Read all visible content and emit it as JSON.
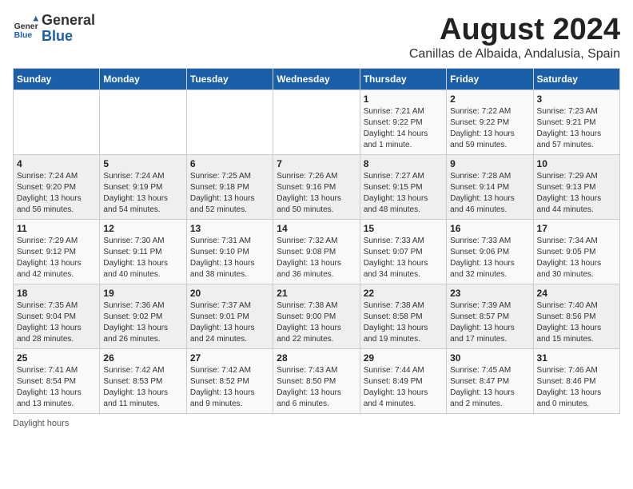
{
  "header": {
    "logo_general": "General",
    "logo_blue": "Blue",
    "month_year": "August 2024",
    "location": "Canillas de Albaida, Andalusia, Spain"
  },
  "columns": [
    "Sunday",
    "Monday",
    "Tuesday",
    "Wednesday",
    "Thursday",
    "Friday",
    "Saturday"
  ],
  "weeks": [
    [
      {
        "day": "",
        "info": ""
      },
      {
        "day": "",
        "info": ""
      },
      {
        "day": "",
        "info": ""
      },
      {
        "day": "",
        "info": ""
      },
      {
        "day": "1",
        "info": "Sunrise: 7:21 AM\nSunset: 9:22 PM\nDaylight: 14 hours\nand 1 minute."
      },
      {
        "day": "2",
        "info": "Sunrise: 7:22 AM\nSunset: 9:22 PM\nDaylight: 13 hours\nand 59 minutes."
      },
      {
        "day": "3",
        "info": "Sunrise: 7:23 AM\nSunset: 9:21 PM\nDaylight: 13 hours\nand 57 minutes."
      }
    ],
    [
      {
        "day": "4",
        "info": "Sunrise: 7:24 AM\nSunset: 9:20 PM\nDaylight: 13 hours\nand 56 minutes."
      },
      {
        "day": "5",
        "info": "Sunrise: 7:24 AM\nSunset: 9:19 PM\nDaylight: 13 hours\nand 54 minutes."
      },
      {
        "day": "6",
        "info": "Sunrise: 7:25 AM\nSunset: 9:18 PM\nDaylight: 13 hours\nand 52 minutes."
      },
      {
        "day": "7",
        "info": "Sunrise: 7:26 AM\nSunset: 9:16 PM\nDaylight: 13 hours\nand 50 minutes."
      },
      {
        "day": "8",
        "info": "Sunrise: 7:27 AM\nSunset: 9:15 PM\nDaylight: 13 hours\nand 48 minutes."
      },
      {
        "day": "9",
        "info": "Sunrise: 7:28 AM\nSunset: 9:14 PM\nDaylight: 13 hours\nand 46 minutes."
      },
      {
        "day": "10",
        "info": "Sunrise: 7:29 AM\nSunset: 9:13 PM\nDaylight: 13 hours\nand 44 minutes."
      }
    ],
    [
      {
        "day": "11",
        "info": "Sunrise: 7:29 AM\nSunset: 9:12 PM\nDaylight: 13 hours\nand 42 minutes."
      },
      {
        "day": "12",
        "info": "Sunrise: 7:30 AM\nSunset: 9:11 PM\nDaylight: 13 hours\nand 40 minutes."
      },
      {
        "day": "13",
        "info": "Sunrise: 7:31 AM\nSunset: 9:10 PM\nDaylight: 13 hours\nand 38 minutes."
      },
      {
        "day": "14",
        "info": "Sunrise: 7:32 AM\nSunset: 9:08 PM\nDaylight: 13 hours\nand 36 minutes."
      },
      {
        "day": "15",
        "info": "Sunrise: 7:33 AM\nSunset: 9:07 PM\nDaylight: 13 hours\nand 34 minutes."
      },
      {
        "day": "16",
        "info": "Sunrise: 7:33 AM\nSunset: 9:06 PM\nDaylight: 13 hours\nand 32 minutes."
      },
      {
        "day": "17",
        "info": "Sunrise: 7:34 AM\nSunset: 9:05 PM\nDaylight: 13 hours\nand 30 minutes."
      }
    ],
    [
      {
        "day": "18",
        "info": "Sunrise: 7:35 AM\nSunset: 9:04 PM\nDaylight: 13 hours\nand 28 minutes."
      },
      {
        "day": "19",
        "info": "Sunrise: 7:36 AM\nSunset: 9:02 PM\nDaylight: 13 hours\nand 26 minutes."
      },
      {
        "day": "20",
        "info": "Sunrise: 7:37 AM\nSunset: 9:01 PM\nDaylight: 13 hours\nand 24 minutes."
      },
      {
        "day": "21",
        "info": "Sunrise: 7:38 AM\nSunset: 9:00 PM\nDaylight: 13 hours\nand 22 minutes."
      },
      {
        "day": "22",
        "info": "Sunrise: 7:38 AM\nSunset: 8:58 PM\nDaylight: 13 hours\nand 19 minutes."
      },
      {
        "day": "23",
        "info": "Sunrise: 7:39 AM\nSunset: 8:57 PM\nDaylight: 13 hours\nand 17 minutes."
      },
      {
        "day": "24",
        "info": "Sunrise: 7:40 AM\nSunset: 8:56 PM\nDaylight: 13 hours\nand 15 minutes."
      }
    ],
    [
      {
        "day": "25",
        "info": "Sunrise: 7:41 AM\nSunset: 8:54 PM\nDaylight: 13 hours\nand 13 minutes."
      },
      {
        "day": "26",
        "info": "Sunrise: 7:42 AM\nSunset: 8:53 PM\nDaylight: 13 hours\nand 11 minutes."
      },
      {
        "day": "27",
        "info": "Sunrise: 7:42 AM\nSunset: 8:52 PM\nDaylight: 13 hours\nand 9 minutes."
      },
      {
        "day": "28",
        "info": "Sunrise: 7:43 AM\nSunset: 8:50 PM\nDaylight: 13 hours\nand 6 minutes."
      },
      {
        "day": "29",
        "info": "Sunrise: 7:44 AM\nSunset: 8:49 PM\nDaylight: 13 hours\nand 4 minutes."
      },
      {
        "day": "30",
        "info": "Sunrise: 7:45 AM\nSunset: 8:47 PM\nDaylight: 13 hours\nand 2 minutes."
      },
      {
        "day": "31",
        "info": "Sunrise: 7:46 AM\nSunset: 8:46 PM\nDaylight: 13 hours\nand 0 minutes."
      }
    ]
  ],
  "footer": {
    "note": "Daylight hours"
  }
}
